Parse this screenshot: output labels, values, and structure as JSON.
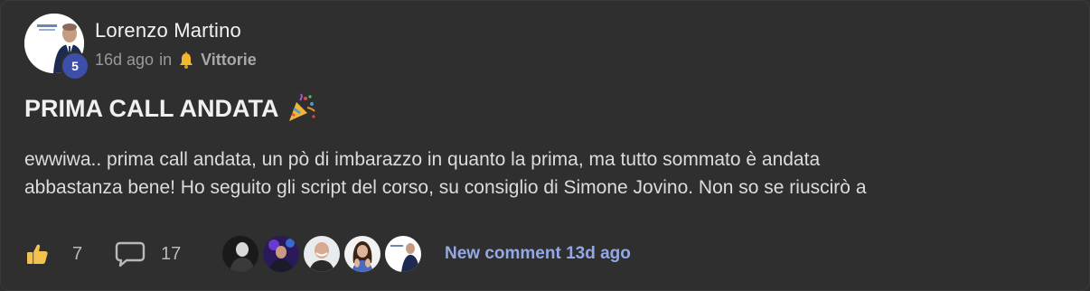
{
  "post": {
    "author": {
      "name": "Lorenzo Martino",
      "level": "5"
    },
    "meta": {
      "time": "16d ago",
      "in_label": "in",
      "category": "Vittorie"
    },
    "title": "PRIMA CALL ANDATA",
    "body": [
      "ewwiwa.. prima call andata, un pò di imbarazzo in quanto la prima, ma tutto sommato è andata",
      "abbastanza bene! Ho seguito gli script del corso, su consiglio di Simone Jovino. Non so se riuscirò a"
    ],
    "footer": {
      "likes": "7",
      "comments": "17",
      "new_comment": "New comment 13d ago"
    }
  },
  "icons": {
    "bell": "bell-icon",
    "party": "party-popper-icon",
    "like": "thumbs-up-icon",
    "comment": "comment-icon"
  },
  "colors": {
    "background": "#2f2f2f",
    "level_badge": "#3d4fa8",
    "link": "#95a8e6"
  }
}
